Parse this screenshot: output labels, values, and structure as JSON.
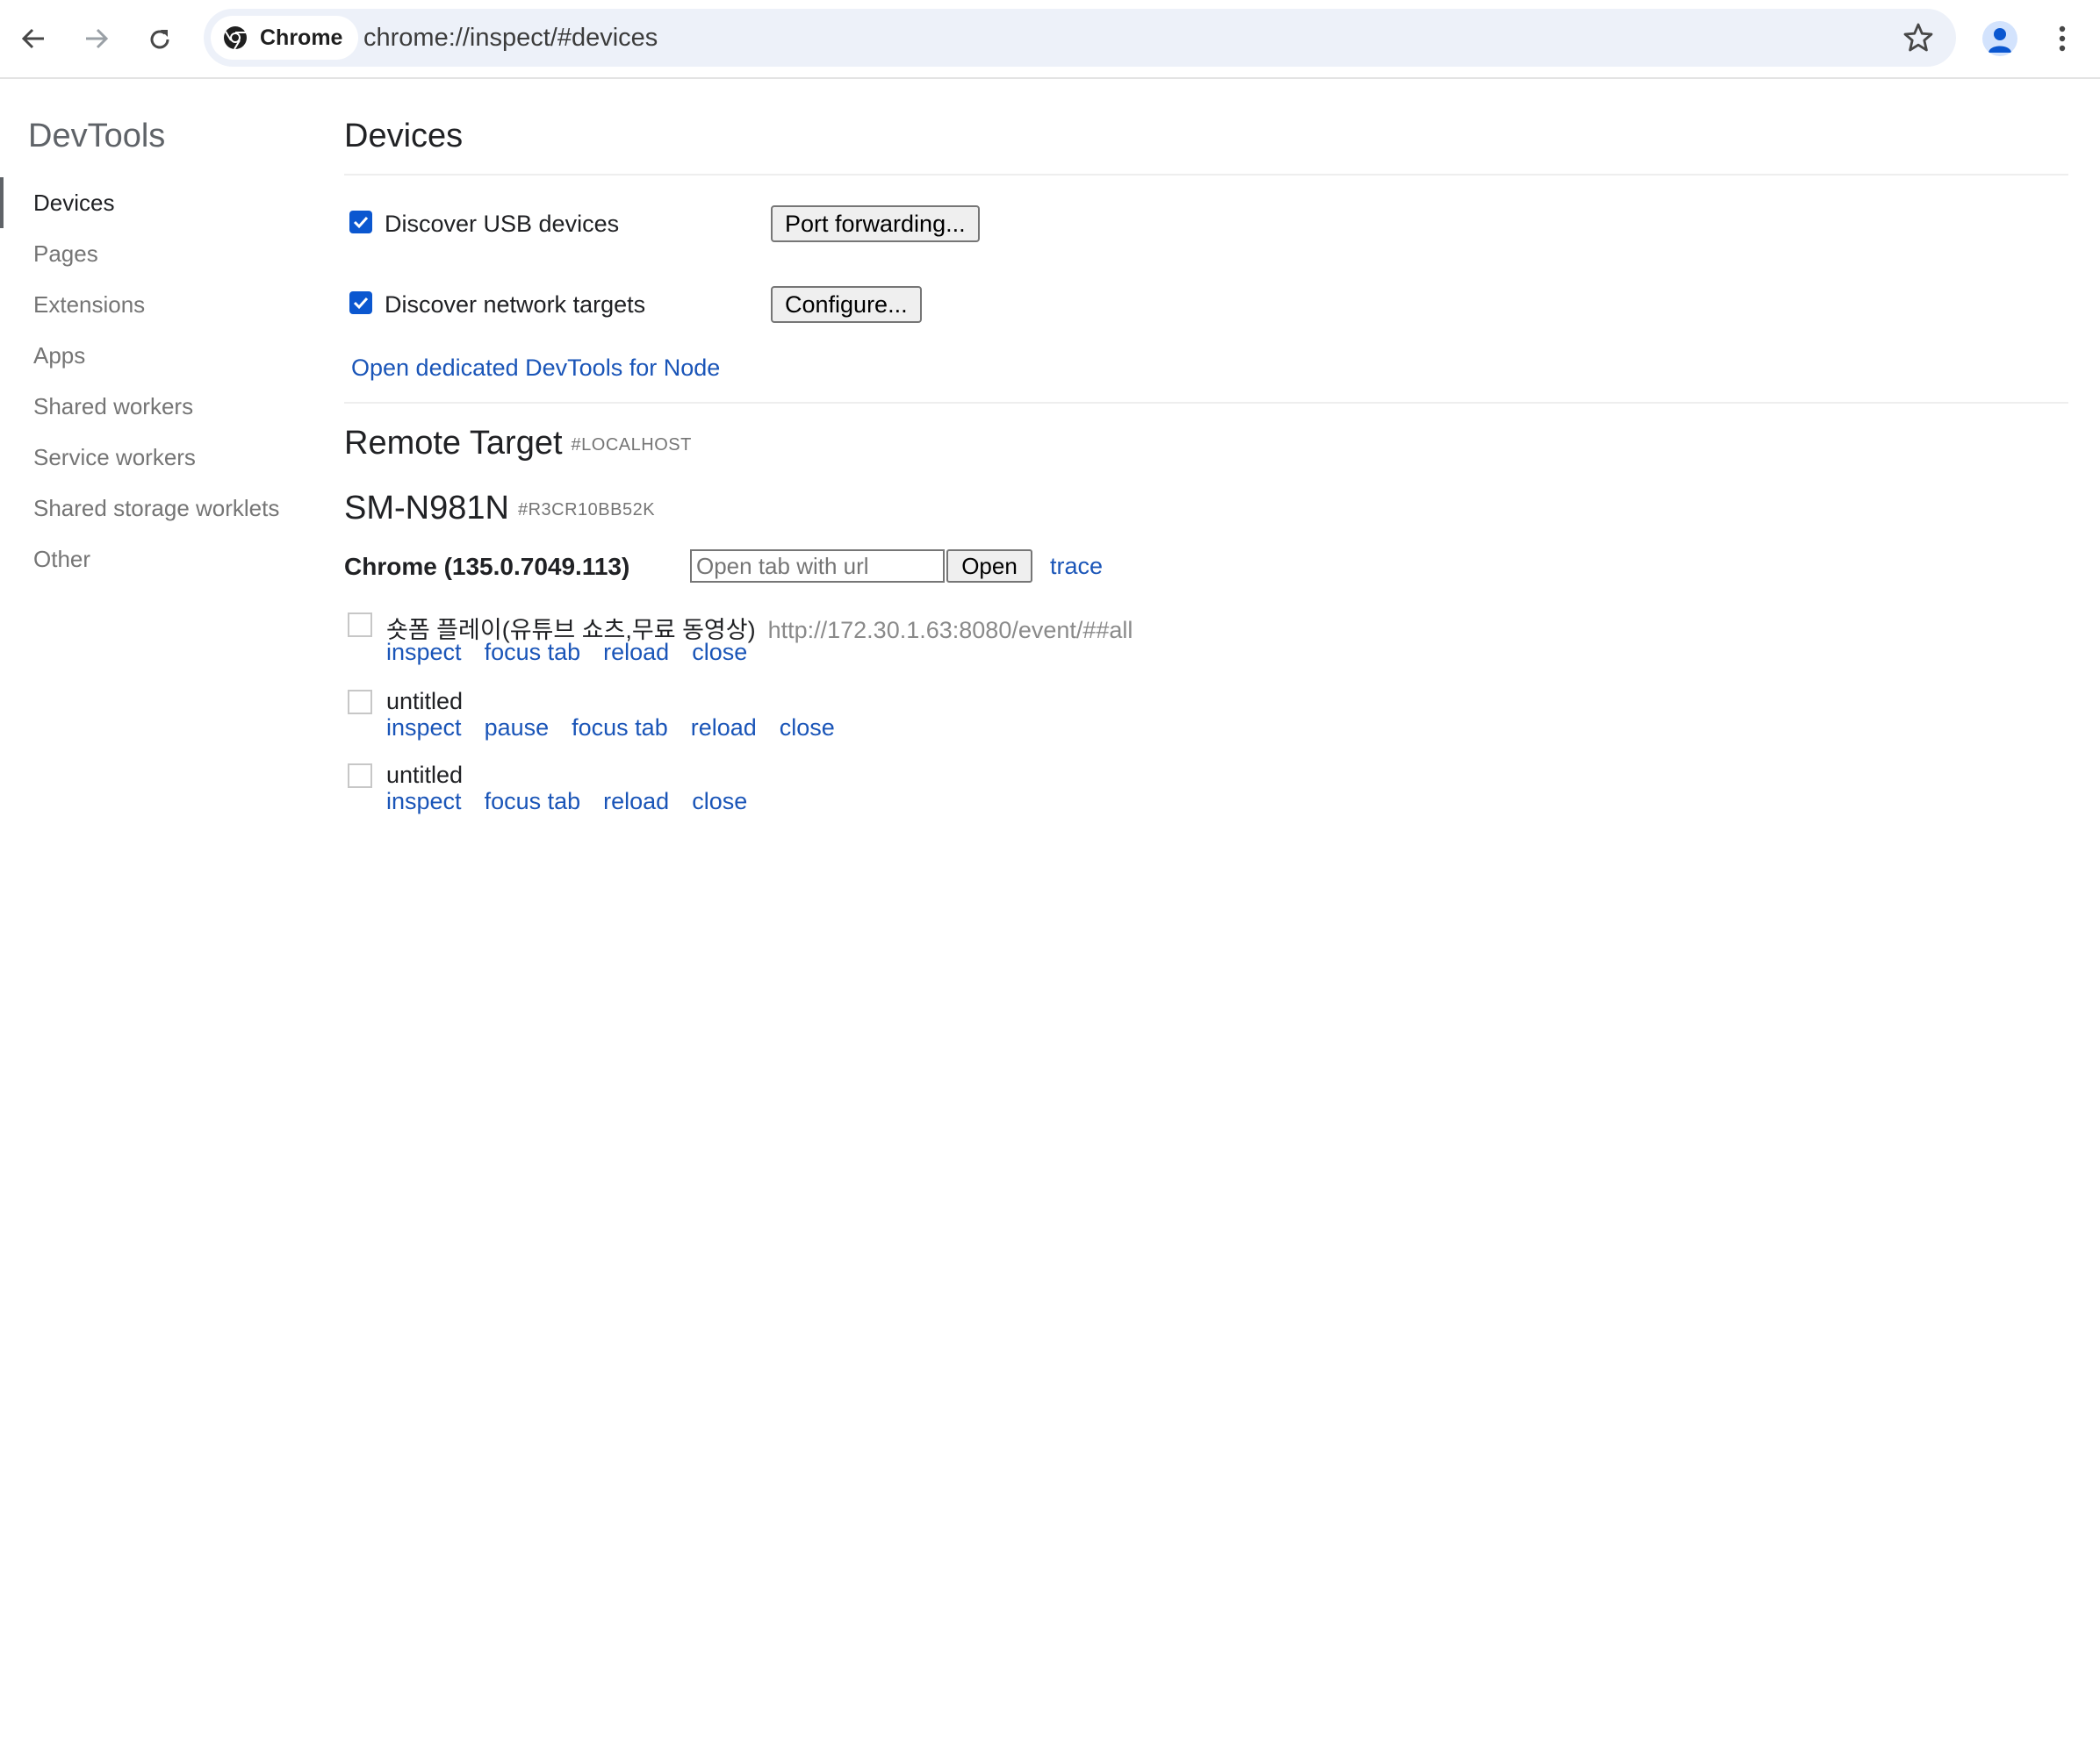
{
  "browser": {
    "chip_label": "Chrome",
    "url": "chrome://inspect/#devices"
  },
  "sidebar": {
    "title": "DevTools",
    "items": [
      {
        "label": "Devices",
        "active": true
      },
      {
        "label": "Pages",
        "active": false
      },
      {
        "label": "Extensions",
        "active": false
      },
      {
        "label": "Apps",
        "active": false
      },
      {
        "label": "Shared workers",
        "active": false
      },
      {
        "label": "Service workers",
        "active": false
      },
      {
        "label": "Shared storage worklets",
        "active": false
      },
      {
        "label": "Other",
        "active": false
      }
    ]
  },
  "main": {
    "title": "Devices",
    "options": [
      {
        "label": "Discover USB devices",
        "checked": true,
        "button": "Port forwarding..."
      },
      {
        "label": "Discover network targets",
        "checked": true,
        "button": "Configure..."
      }
    ],
    "node_link": "Open dedicated DevTools for Node",
    "remote_target": {
      "title": "Remote Target",
      "tag": "#LOCALHOST"
    },
    "device": {
      "name": "SM-N981N",
      "serial": "#R3CR10BB52K"
    },
    "browser_entry": {
      "name": "Chrome (135.0.7049.113)",
      "url_placeholder": "Open tab with url",
      "open_label": "Open",
      "trace_label": "trace"
    },
    "targets": [
      {
        "title": "숏폼 플레이(유튜브 쇼츠,무료 동영상)",
        "url": "http://172.30.1.63:8080/event/##all",
        "actions": [
          "inspect",
          "focus tab",
          "reload",
          "close"
        ]
      },
      {
        "title": "untitled",
        "url": "",
        "actions": [
          "inspect",
          "pause",
          "focus tab",
          "reload",
          "close"
        ]
      },
      {
        "title": "untitled",
        "url": "",
        "actions": [
          "inspect",
          "focus tab",
          "reload",
          "close"
        ]
      }
    ]
  },
  "colors": {
    "link": "#1a55b8",
    "checkbox": "#0b57d0",
    "muted": "#757575"
  }
}
